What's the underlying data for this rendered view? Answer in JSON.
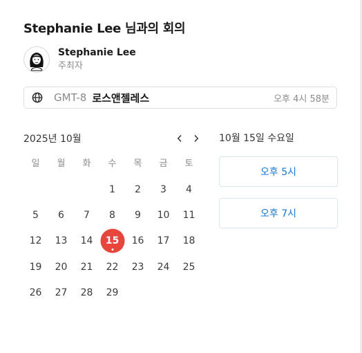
{
  "header": {
    "title": "Stephanie Lee 님과의 회의"
  },
  "host": {
    "name": "Stephanie Lee",
    "role": "주최자",
    "avatar_icon": "woman-portrait-icon"
  },
  "timezone": {
    "icon": "globe-icon",
    "code": "GMT-8",
    "city": "로스앤젤레스",
    "current_time": "오후 4시 58분"
  },
  "calendar": {
    "month_label": "2025년 10월",
    "prev_icon": "chevron-left-icon",
    "next_icon": "chevron-right-icon",
    "weekdays": [
      "일",
      "월",
      "화",
      "수",
      "목",
      "금",
      "토"
    ],
    "leading_blanks": 3,
    "days": [
      "1",
      "2",
      "3",
      "4",
      "5",
      "6",
      "7",
      "8",
      "9",
      "10",
      "11",
      "12",
      "13",
      "14",
      "15",
      "16",
      "17",
      "18",
      "19",
      "20",
      "21",
      "22",
      "23",
      "24",
      "25",
      "26",
      "27",
      "28",
      "29"
    ],
    "selected_day": "15",
    "selected_color": "#e8453c"
  },
  "slots": {
    "date_heading": "10월 15일 수요일",
    "times": [
      "오후 5시",
      "오후 7시"
    ],
    "accent_color": "#1877d6"
  }
}
